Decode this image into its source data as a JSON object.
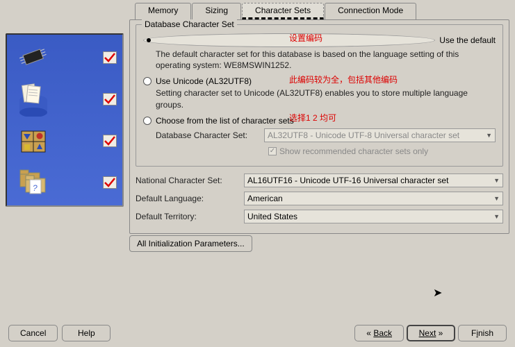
{
  "tabs": {
    "memory": "Memory",
    "sizing": "Sizing",
    "charsets": "Character Sets",
    "connmode": "Connection Mode"
  },
  "group": {
    "title": "Database Character Set",
    "opt1": {
      "label": "Use the default",
      "desc": "The default character set for this database is based on the language setting of this operating system: WE8MSWIN1252."
    },
    "opt2": {
      "label": "Use Unicode (AL32UTF8)",
      "desc": "Setting character set to Unicode (AL32UTF8) enables you to store multiple language groups."
    },
    "opt3": {
      "label": "Choose from the list of character sets"
    },
    "dbcs_label": "Database Character Set:",
    "dbcs_value": "AL32UTF8 - Unicode UTF-8 Universal character set",
    "show_rec": "Show recommended character sets only"
  },
  "annotations": {
    "a1": "设置编码",
    "a2": "此编码较为全，包括其他编码",
    "a3": "选择1 2 均可"
  },
  "form": {
    "ncs_label": "National Character Set:",
    "ncs_value": "AL16UTF16 - Unicode UTF-16 Universal character set",
    "lang_label": "Default Language:",
    "lang_value": "American",
    "terr_label": "Default Territory:",
    "terr_value": "United States"
  },
  "params_btn": "All Initialization Parameters...",
  "footer": {
    "cancel": "Cancel",
    "help": "Help",
    "back": "Back",
    "next": "Next",
    "finish": "Finish"
  }
}
